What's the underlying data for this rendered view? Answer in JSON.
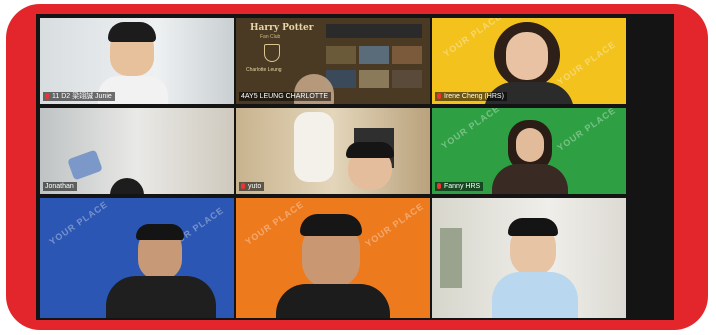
{
  "participants": [
    {
      "name": "11 D2 梁翊誠 Junie",
      "muted": true
    },
    {
      "name": "4AY5 LEUNG CHARLOTTE",
      "muted": false,
      "active": true,
      "shared_screen": {
        "logo_line1": "Harry Potter",
        "logo_line2": "Fan Club",
        "caption": "Charlotte Leung"
      }
    },
    {
      "name": "Irene Cheng (HRS)",
      "muted": true
    },
    {
      "name": "Jonathan",
      "muted": false
    },
    {
      "name": "yuto",
      "muted": true
    },
    {
      "name": "Fanny HRS",
      "muted": true
    },
    {
      "name": "",
      "muted": false
    },
    {
      "name": "",
      "muted": false
    },
    {
      "name": "",
      "muted": false
    }
  ],
  "backgrounds": {
    "pattern_word": "YOUR PLACE",
    "colors": {
      "yellow": "#f3c21c",
      "green": "#2ea043",
      "blue": "#2b56b3",
      "orange": "#ee7a1e",
      "frame": "#e3262b"
    }
  }
}
